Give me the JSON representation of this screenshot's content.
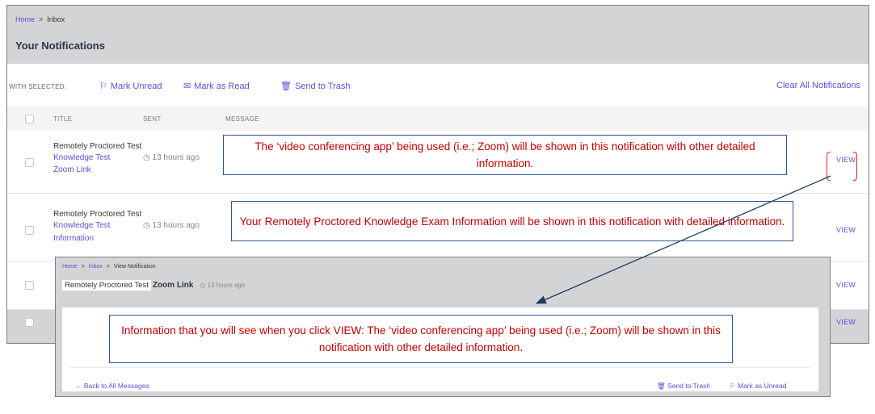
{
  "inbox": {
    "breadcrumb": {
      "home": "Home",
      "separator": ">",
      "current": "Inbox"
    },
    "title": "Your Notifications",
    "with_selected": "WITH SELECTED:",
    "actions": {
      "mark_unread": "Mark Unread",
      "mark_read": "Mark as Read",
      "send_trash": "Send to Trash",
      "clear_all": "Clear All Notifications"
    },
    "columns": {
      "title": "TITLE",
      "sent": "SENT",
      "message": "MESSAGE"
    },
    "rows": [
      {
        "title": "Remotely Proctored Test",
        "subtitle_a": "Knowledge Test",
        "subtitle_b": "Zoom Link",
        "sent": "13 hours ago",
        "view": "VIEW"
      },
      {
        "title": "Remotely Proctored Test",
        "subtitle_a": "Knowledge Test",
        "subtitle_b": "Information",
        "sent": "13 hours ago",
        "view": "VIEW"
      },
      {
        "view": "VIEW"
      },
      {
        "view": "VIEW"
      }
    ]
  },
  "callouts": {
    "zoom": "The ‘video conferencing app’ being used (i.e.; Zoom) will be shown in this notification with other detailed information.",
    "exam": "Your Remotely Proctored Knowledge Exam Information will be shown in this notification with detailed information.",
    "view_info": "Information that you will see when you click VIEW:  The ‘video conferencing app’ being used (i.e.; Zoom) will be shown in this notification with other detailed information."
  },
  "detail": {
    "breadcrumb": {
      "home": "Home",
      "separator": ">",
      "inbox": "Inbox",
      "current": "View Notification"
    },
    "title_pill": "Remotely Proctored Test",
    "title_bold": "Zoom Link",
    "time": "13 hours ago",
    "back": "Back to All Messages",
    "send_trash": "Send to Trash",
    "mark_unread": "Mark as Unread"
  },
  "colors": {
    "accent": "#5b4fd8",
    "callout_text": "#c00000",
    "callout_border": "#2f5597",
    "header_bg": "#d3d4d6"
  },
  "icons": [
    "flag-icon",
    "envelope-icon",
    "trash-icon",
    "clock-icon",
    "arrow-left-icon",
    "checkbox-icon"
  ]
}
